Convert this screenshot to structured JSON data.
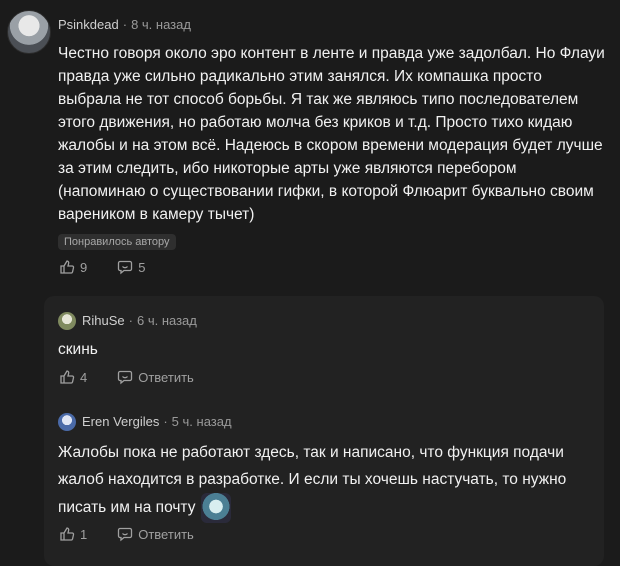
{
  "main_comment": {
    "author": "Psinkdead",
    "separator": "·",
    "time": "8 ч. назад",
    "text": "Честно говоря около эро контент в ленте и правда уже задолбал. Но Флауи правда уже сильно радикально этим занялся. Их компашка просто выбрала не тот способ борьбы. Я так же являюсь типо последователем этого движения, но работаю молча без криков и т.д. Просто тихо кидаю жалобы и на этом всё. Надеюсь в скором времени модерация будет лучше за этим следить, ибо никоторые арты уже являются перебором (напоминаю о существовании гифки, в которой Флюарит буквально своим вареником в камеру тычет)",
    "badge": "Понравилось автору",
    "likes": "9",
    "replies": "5",
    "like_icon": "thumbs-up-icon",
    "reply_icon": "comment-icon"
  },
  "replies": [
    {
      "author": "RihuSe",
      "separator": "·",
      "time": "6 ч. назад",
      "text": "скинь",
      "likes": "4",
      "reply_label": "Ответить"
    },
    {
      "author": "Eren Vergiles",
      "separator": "·",
      "time": "5 ч. назад",
      "text": "Жалобы пока не работают здесь, так и написано, что функция подачи жалоб находится в разработке. И если ты хочешь настучать, то нужно писать им на почту",
      "likes": "1",
      "reply_label": "Ответить"
    }
  ],
  "colors": {
    "background": "#1b1b1b",
    "reply_panel": "#222222",
    "text": "#f1f1f1",
    "muted": "#9a9a9a"
  }
}
